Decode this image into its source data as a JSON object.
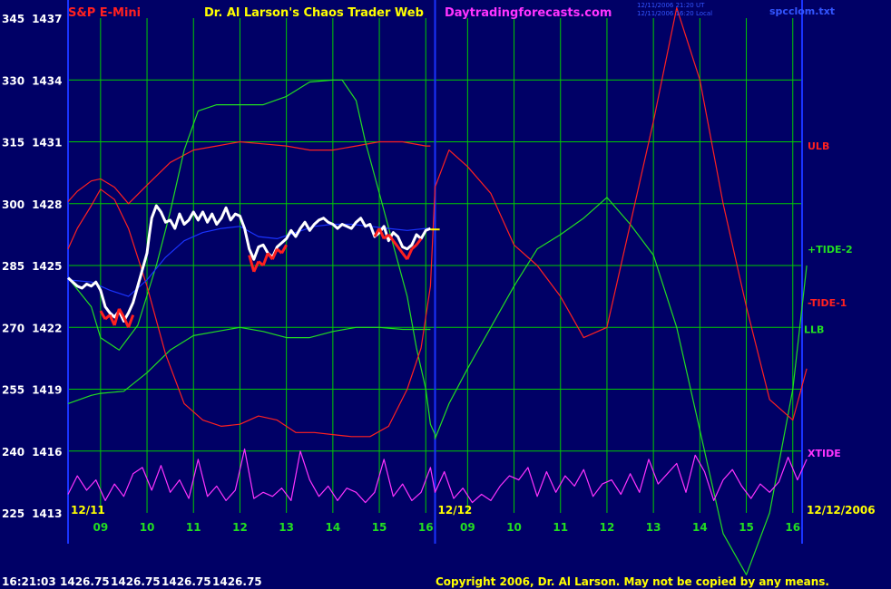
{
  "header": {
    "instrument": "S&P E-Mini",
    "title": "Dr. Al Larson's Chaos Trader Web",
    "site": "Daytradingforecasts.com",
    "file": "spcclom.txt",
    "timestamps": [
      "12/11/2006 21:20 UT",
      "12/11/2006 16:20 Local"
    ]
  },
  "footer": {
    "time": "16:21:03",
    "quotes": [
      "1426.75",
      "1426.75",
      "1426.75",
      "1426.75"
    ],
    "copyright": "Copyright 2006, Dr. Al Larson. May not be copied by any means."
  },
  "colors": {
    "background": "#000066",
    "grid": "#00cc00",
    "red": "#ff2020",
    "green": "#22dd22",
    "magenta": "#ff33ff",
    "blue": "#1a33ff",
    "yellow": "#ffff00",
    "white": "#ffffff"
  },
  "chart_data": {
    "type": "line",
    "x_tick_labels": [
      "09",
      "10",
      "11",
      "12",
      "13",
      "14",
      "15",
      "16",
      "09",
      "10",
      "11",
      "12",
      "13",
      "14",
      "15",
      "16"
    ],
    "date_labels": [
      "12/11",
      "12/12",
      "12/12/2006"
    ],
    "y_ticks": [
      {
        "left": "345",
        "right": "1437"
      },
      {
        "left": "330",
        "right": "1434"
      },
      {
        "left": "315",
        "right": "1431"
      },
      {
        "left": "300",
        "right": "1428"
      },
      {
        "left": "285",
        "right": "1425"
      },
      {
        "left": "270",
        "right": "1422"
      },
      {
        "left": "255",
        "right": "1419"
      },
      {
        "left": "240",
        "right": "1416"
      },
      {
        "left": "225",
        "right": "1413"
      }
    ],
    "ylim_left": [
      225,
      345
    ],
    "ylim_right": [
      1413,
      1437
    ],
    "xlim_hours": [
      8.3,
      16.2
    ],
    "grid": true,
    "series": [
      {
        "name": "ULB",
        "color": "#ff2020",
        "x": [
          8.3,
          8.5,
          8.8,
          9.0,
          9.3,
          9.6,
          10.0,
          10.5,
          11.0,
          11.5,
          12.0,
          12.5,
          13.0,
          13.5,
          14.0,
          14.5,
          15.0,
          15.5,
          16.0,
          16.1
        ],
        "y": [
          1428.1,
          1428.6,
          1429.1,
          1429.2,
          1428.8,
          1428.0,
          1428.9,
          1430.0,
          1430.6,
          1430.8,
          1431.0,
          1430.9,
          1430.8,
          1430.6,
          1430.6,
          1430.8,
          1431.0,
          1431.0,
          1430.8,
          1430.8
        ]
      },
      {
        "name": "LLB",
        "color": "#22dd22",
        "x": [
          8.3,
          8.8,
          9.0,
          9.5,
          10.0,
          10.5,
          11.0,
          11.5,
          12.0,
          12.5,
          13.0,
          13.5,
          14.0,
          14.5,
          15.0,
          15.5,
          16.0,
          16.1
        ],
        "y": [
          1418.3,
          1418.7,
          1418.8,
          1418.9,
          1419.8,
          1420.9,
          1421.6,
          1421.8,
          1422.0,
          1421.8,
          1421.5,
          1421.5,
          1421.8,
          1422.0,
          1422.0,
          1421.9,
          1421.9,
          1421.9
        ]
      },
      {
        "name": "+TIDE-2",
        "color": "#22dd22",
        "x": [
          8.3,
          8.8,
          9.0,
          9.4,
          9.8,
          10.2,
          10.5,
          10.8,
          11.1,
          11.5,
          12.0,
          12.5,
          13.0,
          13.5,
          14.0,
          14.2,
          14.5,
          14.7,
          15.0,
          15.3,
          15.6,
          15.8,
          16.0,
          16.1,
          16.2,
          16.3,
          16.6,
          17.0,
          17.5,
          18.0,
          18.5,
          19.0,
          19.5,
          20.0,
          20.5,
          21.0,
          21.5,
          22.0,
          22.5,
          23.0,
          23.5,
          24.0,
          24.3
        ],
        "y": [
          1424.4,
          1423.0,
          1421.5,
          1420.9,
          1422.1,
          1425.0,
          1427.6,
          1430.6,
          1432.5,
          1432.8,
          1432.8,
          1432.8,
          1433.2,
          1433.9,
          1434.0,
          1434.0,
          1433.0,
          1431.0,
          1428.5,
          1426.0,
          1423.5,
          1421.0,
          1419.0,
          1417.3,
          1416.8,
          1416.6,
          1418.3,
          1420.0,
          1422.0,
          1424.0,
          1425.8,
          1426.5,
          1427.3,
          1428.3,
          1427.0,
          1425.5,
          1422.0,
          1417.0,
          1412.0,
          1410.0,
          1413.0,
          1419.0,
          1425.0
        ]
      },
      {
        "name": "-TIDE-1",
        "color": "#ff2020",
        "x": [
          8.3,
          8.5,
          8.8,
          9.0,
          9.3,
          9.6,
          10.0,
          10.4,
          10.8,
          11.2,
          11.6,
          12.0,
          12.4,
          12.8,
          13.2,
          13.6,
          14.0,
          14.4,
          14.8,
          15.2,
          15.6,
          15.9,
          16.1,
          16.3,
          16.6,
          17.0,
          17.5,
          18.0,
          18.5,
          19.0,
          19.5,
          20.0,
          20.5,
          21.0,
          21.5,
          22.0,
          22.5,
          23.0,
          23.5,
          24.0,
          24.3
        ],
        "y": [
          1425.8,
          1426.8,
          1427.9,
          1428.7,
          1428.2,
          1426.8,
          1424.0,
          1420.7,
          1418.3,
          1417.5,
          1417.2,
          1417.3,
          1417.7,
          1417.5,
          1416.9,
          1416.9,
          1416.8,
          1416.7,
          1416.7,
          1417.2,
          1419.0,
          1421.0,
          1424.0,
          1428.8,
          1430.6,
          1429.8,
          1428.5,
          1426.0,
          1425.0,
          1423.5,
          1421.5,
          1422.0,
          1427.0,
          1432.0,
          1437.5,
          1434.0,
          1428.0,
          1423.0,
          1418.5,
          1417.5,
          1420.0
        ]
      },
      {
        "name": "XTIDE",
        "color": "#ff33ff",
        "x": [
          8.3,
          8.5,
          8.7,
          8.9,
          9.1,
          9.3,
          9.5,
          9.7,
          9.9,
          10.1,
          10.3,
          10.5,
          10.7,
          10.9,
          11.1,
          11.3,
          11.5,
          11.7,
          11.9,
          12.1,
          12.3,
          12.5,
          12.7,
          12.9,
          13.1,
          13.3,
          13.5,
          13.7,
          13.9,
          14.1,
          14.3,
          14.5,
          14.7,
          14.9,
          15.1,
          15.3,
          15.5,
          15.7,
          15.9,
          16.1,
          16.3,
          16.5,
          16.7,
          16.9,
          17.1,
          17.3,
          17.5,
          17.7,
          17.9,
          18.1,
          18.3,
          18.5,
          18.7,
          18.9,
          19.1,
          19.3,
          19.5,
          19.7,
          19.9,
          20.1,
          20.3,
          20.5,
          20.7,
          20.9,
          21.1,
          21.3,
          21.5,
          21.7,
          21.9,
          22.1,
          22.3,
          22.5,
          22.7,
          22.9,
          23.1,
          23.3,
          23.5,
          23.7,
          23.9,
          24.1,
          24.3
        ],
        "y": [
          1413.9,
          1414.8,
          1414.1,
          1414.6,
          1413.6,
          1414.4,
          1413.8,
          1414.9,
          1415.2,
          1414.1,
          1415.3,
          1414.0,
          1414.6,
          1413.7,
          1415.6,
          1413.8,
          1414.3,
          1413.6,
          1414.1,
          1416.1,
          1413.7,
          1414.0,
          1413.8,
          1414.2,
          1413.6,
          1416.0,
          1414.6,
          1413.8,
          1414.3,
          1413.6,
          1414.2,
          1414.0,
          1413.5,
          1414.0,
          1415.6,
          1413.8,
          1414.4,
          1413.6,
          1414.0,
          1415.2,
          1414.0,
          1415.0,
          1413.7,
          1414.2,
          1413.5,
          1413.9,
          1413.6,
          1414.3,
          1414.8,
          1414.6,
          1415.2,
          1413.8,
          1415.0,
          1414.0,
          1414.8,
          1414.3,
          1415.1,
          1413.8,
          1414.4,
          1414.6,
          1413.9,
          1414.9,
          1414.0,
          1415.6,
          1414.4,
          1414.9,
          1415.4,
          1414.0,
          1415.8,
          1415.0,
          1413.6,
          1414.6,
          1415.1,
          1414.3,
          1413.7,
          1414.4,
          1414.0,
          1414.5,
          1415.7,
          1414.6,
          1415.6
        ]
      },
      {
        "name": "",
        "color": "#1a33ff",
        "x": [
          8.3,
          8.8,
          9.2,
          9.6,
          10.0,
          10.4,
          10.8,
          11.2,
          11.6,
          12.0,
          12.4,
          12.8,
          13.2,
          13.6,
          14.0,
          14.4,
          14.8,
          15.2,
          15.6,
          16.0,
          16.1
        ],
        "y": [
          1424.3,
          1424.2,
          1423.8,
          1423.5,
          1424.3,
          1425.4,
          1426.2,
          1426.6,
          1426.8,
          1426.9,
          1426.4,
          1426.3,
          1426.6,
          1426.9,
          1427.0,
          1427.0,
          1426.9,
          1426.8,
          1426.7,
          1426.8,
          1426.8
        ]
      },
      {
        "name": "",
        "color": "#ffffff",
        "x": [
          8.3,
          8.4,
          8.5,
          8.6,
          8.7,
          8.8,
          8.9,
          9.0,
          9.1,
          9.2,
          9.3,
          9.4,
          9.5,
          9.6,
          9.7,
          9.8,
          9.9,
          10.0,
          10.05,
          10.1,
          10.2,
          10.3,
          10.4,
          10.5,
          10.6,
          10.7,
          10.8,
          10.9,
          11.0,
          11.1,
          11.2,
          11.3,
          11.4,
          11.5,
          11.6,
          11.7,
          11.8,
          11.9,
          12.0,
          12.1,
          12.2,
          12.3,
          12.4,
          12.5,
          12.6,
          12.7,
          12.8,
          12.9,
          13.0,
          13.1,
          13.2,
          13.3,
          13.4,
          13.5,
          13.6,
          13.7,
          13.8,
          13.9,
          14.0,
          14.1,
          14.2,
          14.3,
          14.4,
          14.5,
          14.6,
          14.7,
          14.8,
          14.9,
          15.0,
          15.1,
          15.2,
          15.3,
          15.4,
          15.5,
          15.6,
          15.7,
          15.8,
          15.9,
          16.0,
          16.1
        ],
        "y": [
          1424.4,
          1424.2,
          1424.0,
          1423.9,
          1424.1,
          1424.0,
          1424.2,
          1423.8,
          1423.0,
          1422.7,
          1422.5,
          1422.8,
          1422.3,
          1422.7,
          1423.2,
          1424.0,
          1424.8,
          1425.6,
          1426.5,
          1427.3,
          1427.9,
          1427.6,
          1427.1,
          1427.2,
          1426.8,
          1427.5,
          1427.0,
          1427.2,
          1427.6,
          1427.2,
          1427.6,
          1427.1,
          1427.5,
          1427.0,
          1427.3,
          1427.8,
          1427.2,
          1427.5,
          1427.4,
          1426.8,
          1425.8,
          1425.3,
          1425.9,
          1426.0,
          1425.6,
          1425.4,
          1425.9,
          1426.1,
          1426.3,
          1426.7,
          1426.4,
          1426.8,
          1427.1,
          1426.7,
          1427.0,
          1427.2,
          1427.3,
          1427.1,
          1427.0,
          1426.8,
          1427.0,
          1426.9,
          1426.8,
          1427.1,
          1427.3,
          1426.9,
          1427.0,
          1426.4,
          1426.6,
          1426.9,
          1426.2,
          1426.6,
          1426.4,
          1425.9,
          1425.8,
          1426.0,
          1426.5,
          1426.3,
          1426.7,
          1426.8
        ]
      },
      {
        "name": "",
        "color": "#ff2020",
        "x": [
          9.0,
          9.1,
          9.2,
          9.3,
          9.4,
          9.5,
          9.6,
          9.7,
          12.2,
          12.3,
          12.4,
          12.5,
          12.6,
          12.7,
          12.8,
          12.9,
          13.0,
          14.9,
          15.0,
          15.1,
          15.2,
          15.3,
          15.4,
          15.5,
          15.6,
          15.7,
          15.8,
          15.9
        ],
        "y": [
          1422.8,
          1422.4,
          1422.6,
          1422.1,
          1422.9,
          1422.5,
          1422.0,
          1422.6,
          1425.5,
          1424.7,
          1425.2,
          1425.0,
          1425.6,
          1425.3,
          1425.8,
          1425.6,
          1426.0,
          1426.4,
          1426.8,
          1426.3,
          1426.5,
          1426.2,
          1425.9,
          1425.6,
          1425.3,
          1425.8,
          1426.0,
          1426.3
        ]
      },
      {
        "name": "",
        "color": "#ffff00",
        "x": [
          16.1,
          16.4
        ],
        "y": [
          1426.75,
          1426.75
        ]
      }
    ],
    "annotations": [
      {
        "text": "ULB",
        "color": "#ff2020",
        "y": 1430.8
      },
      {
        "text": "+TIDE-2",
        "color": "#22dd22",
        "y": 1425.8
      },
      {
        "text": "-TIDE-1",
        "color": "#ff2020",
        "y": 1423.2
      },
      {
        "text": "LLB",
        "color": "#22dd22",
        "y": 1421.9
      },
      {
        "text": "XTIDE",
        "color": "#ff33ff",
        "y": 1415.9
      }
    ]
  }
}
